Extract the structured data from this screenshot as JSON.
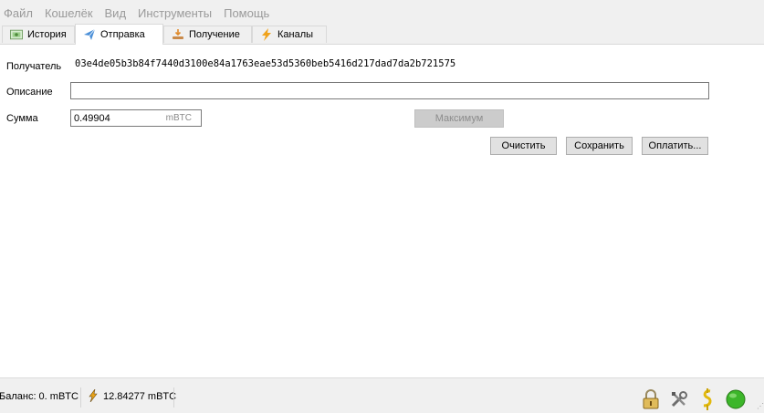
{
  "menu": {
    "items": [
      "Файл",
      "Кошелёк",
      "Вид",
      "Инструменты",
      "Помощь"
    ]
  },
  "tabs": [
    {
      "label": "История",
      "icon": "history-icon"
    },
    {
      "label": "Отправка",
      "icon": "send-icon",
      "active": true
    },
    {
      "label": "Получение",
      "icon": "receive-icon"
    },
    {
      "label": "Каналы",
      "icon": "lightning-icon"
    }
  ],
  "send_form": {
    "recipient_label": "Получатель",
    "recipient_value": "03e4de05b3b84f7440d3100e84a1763eae53d5360beb5416d217dad7da2b721575",
    "description_label": "Описание",
    "description_value": "",
    "amount_label": "Сумма",
    "amount_value": "0.49904",
    "amount_unit": "mBTC",
    "max_button": "Максимум",
    "clear_button": "Очистить",
    "save_button": "Сохранить",
    "pay_button": "Оплатить..."
  },
  "status": {
    "balance": "Баланс: 0. mBTC",
    "lightning_balance": "12.84277 mBTC",
    "icons": [
      "lock-icon",
      "tools-icon",
      "seed-icon",
      "network-status-icon"
    ],
    "network_color": "#3cb62a"
  }
}
